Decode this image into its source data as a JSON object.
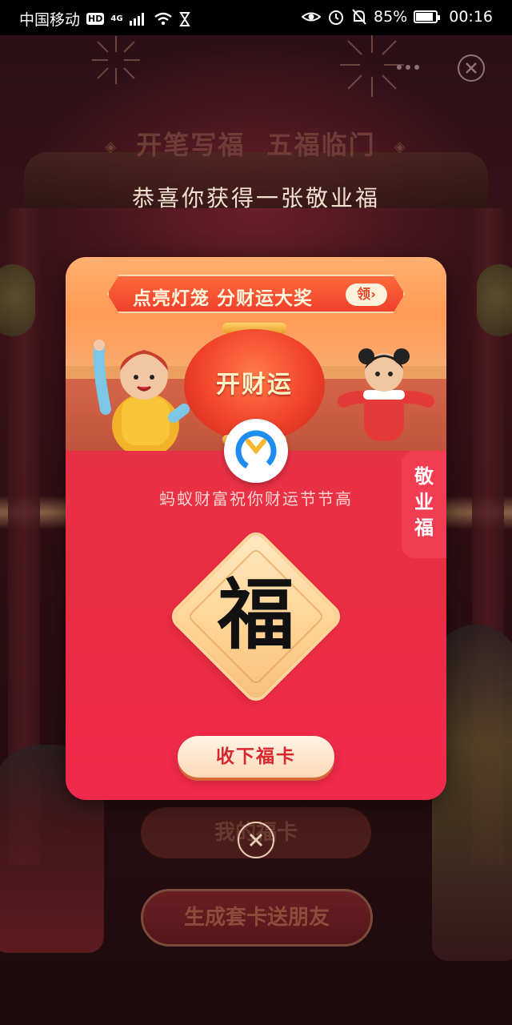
{
  "status_bar": {
    "carrier": "中国移动",
    "hd": "HD",
    "network": "4G",
    "battery": "85%",
    "battery_level": 0.85,
    "time": "00:16"
  },
  "background": {
    "title_part1": "开笔写福",
    "title_part2": "五福临门",
    "congrats": "恭喜你获得一张敬业福",
    "button_my_cards": "我的福卡",
    "button_generate_set": "生成套卡送朋友"
  },
  "modal": {
    "banner_text": "点亮灯笼 分财运大奖",
    "banner_button": "领",
    "lantern_text": "开财运",
    "subtitle": "蚂蚁财富祝你财运节节高",
    "side_tag": "敬业福",
    "fu_char": "福",
    "collect_button": "收下福卡"
  },
  "colors": {
    "card_red": "#ea2e43",
    "banner_orange": "#f0402c",
    "button_text": "#d7282e",
    "diamond_gold": "#ffd493"
  },
  "icons": {
    "logo": "ant-fortune-logo-icon",
    "close": "close-icon",
    "more": "more-dots-icon"
  }
}
